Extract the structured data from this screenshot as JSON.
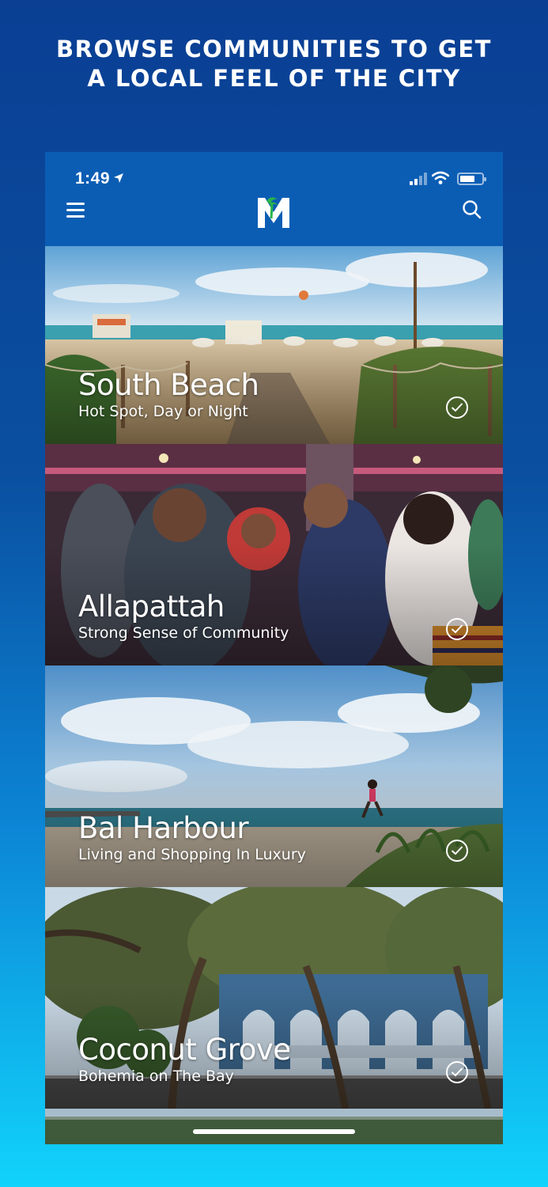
{
  "promo": {
    "line1": "BROWSE COMMUNITIES TO GET",
    "line2": "A LOCAL FEEL OF THE CITY"
  },
  "status": {
    "time": "1:49",
    "location_icon": "location-arrow-icon",
    "signal_icon": "cellular-signal-icon",
    "wifi_icon": "wifi-icon",
    "battery_icon": "battery-icon"
  },
  "nav": {
    "menu_icon": "hamburger-menu-icon",
    "logo_letter": "M",
    "search_icon": "search-icon"
  },
  "communities": [
    {
      "name": "South Beach",
      "tagline": "Hot Spot, Day or Night"
    },
    {
      "name": "Allapattah",
      "tagline": "Strong Sense of Community"
    },
    {
      "name": "Bal Harbour",
      "tagline": "Living and Shopping In Luxury"
    },
    {
      "name": "Coconut Grove",
      "tagline": "Bohemia on The Bay"
    }
  ],
  "colors": {
    "brand_blue": "#0b5db4",
    "bg_top": "#0a3f94",
    "bg_bottom": "#11d3fb",
    "logo_green": "#27b34a"
  }
}
